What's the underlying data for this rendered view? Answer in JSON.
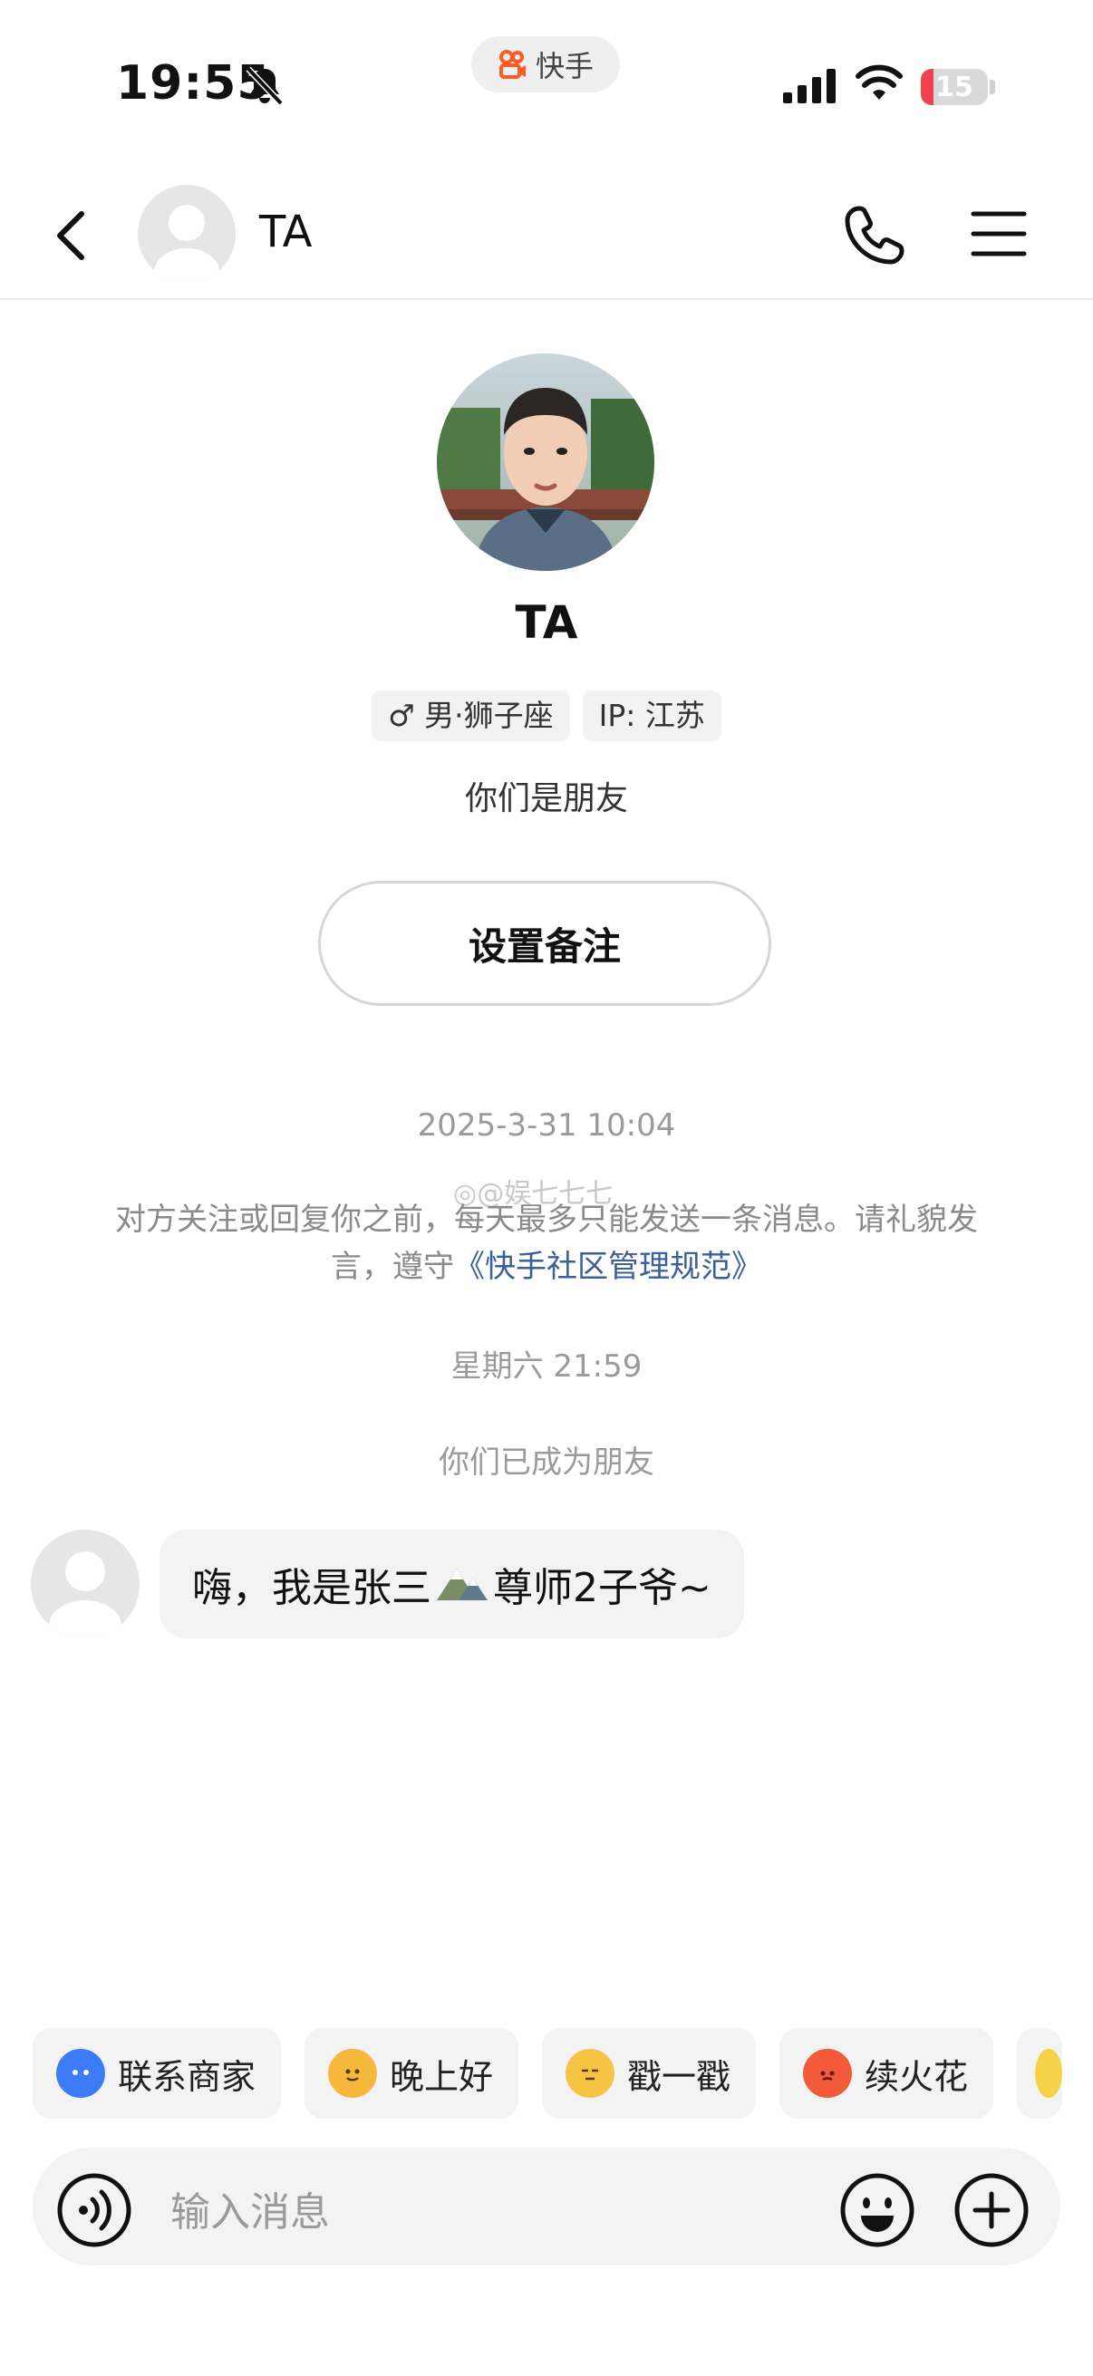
{
  "status_bar": {
    "time": "19:55",
    "app_badge": "快手",
    "battery": "15",
    "icons": [
      "bell-off-icon",
      "signal-icon",
      "wifi-icon",
      "battery-icon"
    ]
  },
  "header": {
    "title": "TA",
    "icons": [
      "back-arrow-icon",
      "avatar-placeholder-icon",
      "phone-icon",
      "menu-icon"
    ]
  },
  "profile": {
    "name": "TA",
    "gender_tag": "♂ 男·狮子座",
    "ip_tag": "IP: 江苏",
    "relation": "你们是朋友",
    "remark_button": "设置备注"
  },
  "chat": {
    "timestamp_1": "2025-3-31 10:04",
    "watermark": "@娱七七七",
    "notice_text": "对方关注或回复你之前，每天最多只能发送一条消息。请礼貌发言，遵守",
    "notice_link": "《快手社区管理规范》",
    "timestamp_2": "星期六 21:59",
    "friends_notice": "你们已成为朋友",
    "message_before": "嗨，我是张三",
    "message_after": "尊师2子爷~"
  },
  "quick_replies": [
    {
      "label": "联系商家",
      "icon": "chat-bubble-icon",
      "color": "#3d7bf7"
    },
    {
      "label": "晚上好",
      "icon": "moon-face-icon",
      "color": "#f6b73c"
    },
    {
      "label": "戳一戳",
      "icon": "poke-face-icon",
      "color": "#f6c342"
    },
    {
      "label": "续火花",
      "icon": "fire-face-icon",
      "color": "#f25a3a"
    }
  ],
  "input": {
    "placeholder": "输入消息",
    "value": ""
  },
  "colors": {
    "accent_link": "#3b5f98",
    "brand": "#ff5a1f",
    "battery_low": "#f0414e"
  }
}
